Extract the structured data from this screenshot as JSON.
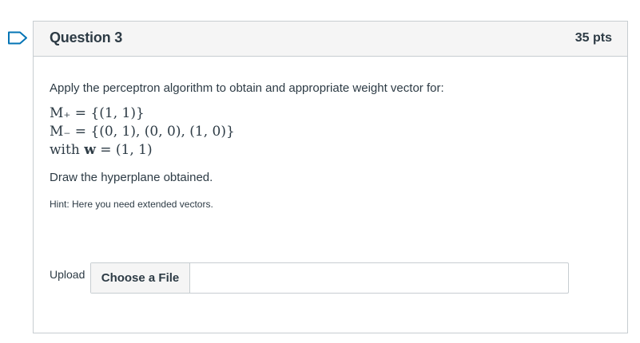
{
  "question": {
    "title": "Question 3",
    "points": "35 pts",
    "prompt": "Apply the perceptron algorithm to obtain and appropriate weight vector for:",
    "math": {
      "m_plus": "M₊ = {(1, 1)}",
      "m_minus": "M₋ = {(0, 1), (0, 0), (1, 0)}",
      "with_prefix": "with ",
      "with_w": "w",
      "with_suffix": " = (1, 1)"
    },
    "draw_instruction": "Draw the hyperplane obtained.",
    "hint": "Hint: Here you need extended vectors."
  },
  "upload": {
    "label": "Upload",
    "button_label": "Choose a File",
    "file_name": ""
  },
  "colors": {
    "accent_flag": "#0374b5",
    "text": "#2d3b45",
    "border": "#c7cdd1",
    "header_bg": "#f5f5f5"
  },
  "icons": {
    "flag": "flag-outline-icon"
  }
}
